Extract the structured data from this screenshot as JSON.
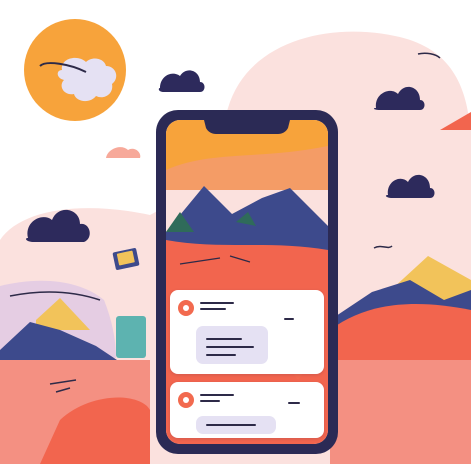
{
  "colors": {
    "sky": "#f7a99a",
    "blush": "#fbe1de",
    "sun": "#f7a33b",
    "cloud_dark": "#2d2a5c",
    "mountain_navy": "#3d4a8c",
    "mountain_sand": "#f2c35a",
    "coral": "#f2654e",
    "phone_frame": "#2b2a55",
    "card_bg": "#ffffff",
    "bubble": "#e5e1f3",
    "pin": "#f26a4f"
  },
  "icons": {
    "sun": "sun-icon",
    "cloud": "cloud-icon",
    "location_pin": "location-pin-icon",
    "book": "book-icon"
  },
  "cards": [
    {
      "name": "location-card-1"
    },
    {
      "name": "location-card-2"
    }
  ]
}
